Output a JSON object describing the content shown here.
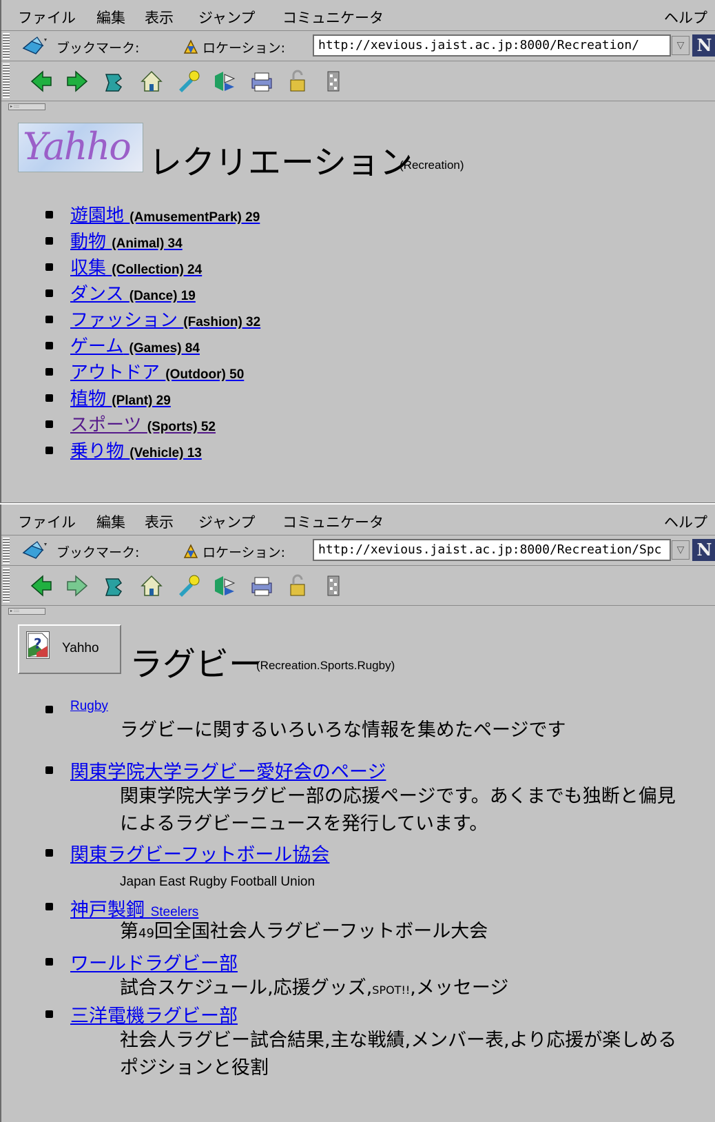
{
  "window1": {
    "menu": [
      "ファイル",
      "編集",
      "表示",
      "ジャンプ",
      "コミュニケータ"
    ],
    "help": "ヘルプ",
    "bookmarks_label": "ブックマーク:",
    "location_label": "ロケーション:",
    "url": "http://xevious.jaist.ac.jp:8000/Recreation/",
    "logo_text": "Yahho",
    "title": "レクリエーション",
    "subtitle": "(Recreation)",
    "categories": [
      {
        "ja": "遊園地",
        "en": "(AmusementPark) 29"
      },
      {
        "ja": "動物",
        "en": "(Animal) 34"
      },
      {
        "ja": "収集",
        "en": "(Collection) 24"
      },
      {
        "ja": "ダンス",
        "en": "(Dance) 19"
      },
      {
        "ja": "ファッション",
        "en": "(Fashion) 32"
      },
      {
        "ja": "ゲーム",
        "en": "(Games) 84"
      },
      {
        "ja": "アウトドア",
        "en": "(Outdoor) 50"
      },
      {
        "ja": "植物",
        "en": "(Plant) 29"
      },
      {
        "ja": "スポーツ",
        "en": "(Sports) 52"
      },
      {
        "ja": "乗り物",
        "en": "(Vehicle) 13"
      }
    ]
  },
  "window2": {
    "menu": [
      "ファイル",
      "編集",
      "表示",
      "ジャンプ",
      "コミュニケータ"
    ],
    "help": "ヘルプ",
    "bookmarks_label": "ブックマーク:",
    "location_label": "ロケーション:",
    "url": "http://xevious.jaist.ac.jp:8000/Recreation/Spc",
    "image_alt": "Yahho",
    "title": "ラグビー",
    "subtitle": "(Recreation.Sports.Rugby)",
    "links": [
      {
        "link": "Rugby",
        "desc": "ラグビーに関するいろいろな情報を集めたページです"
      },
      {
        "link": "関東学院大学ラグビー愛好会のページ",
        "desc": "関東学院大学ラグビー部の応援ページです。あくまでも独断と偏見によるラグビーニュースを発行しています。"
      },
      {
        "link": "関東ラグビーフットボール協会",
        "desc": "Japan East Rugby Football Union"
      },
      {
        "link": "神戸製鋼",
        "link_extra": "Steelers",
        "desc_pre": "第",
        "desc_num": "49",
        "desc": "回全国社会人ラグビーフットボール大会"
      },
      {
        "link": "ワールドラグビー部",
        "desc_a": "試合スケジュール,応援グッズ,",
        "desc_b": "SPOT!!",
        "desc_c": ",メッセージ"
      },
      {
        "link": "三洋電機ラグビー部",
        "desc": "社会人ラグビー試合結果,主な戦績,メンバー表,より応援が楽しめるポジションと役割"
      }
    ]
  }
}
